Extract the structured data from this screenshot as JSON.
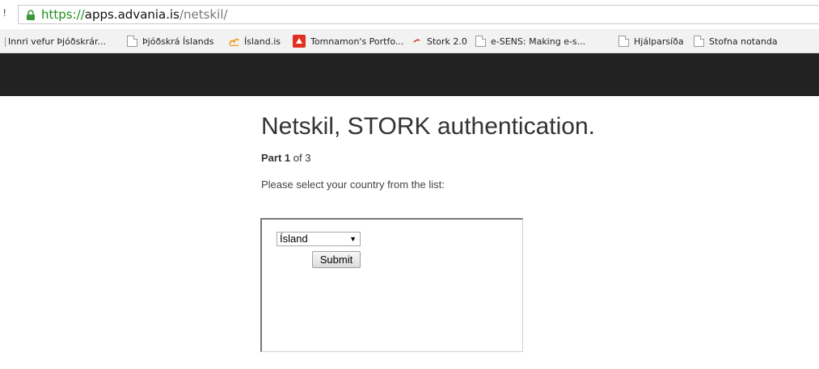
{
  "browser": {
    "url_scheme": "https://",
    "url_host": "apps.advania.is",
    "url_path": "/netskil/",
    "left_edge_glyph": "!"
  },
  "bookmarks": [
    {
      "label": "Innri vefur Þjóðskrár...",
      "icon": "none"
    },
    {
      "label": "Þjóðskrá Íslands",
      "icon": "page-icon"
    },
    {
      "label": "Ísland.is",
      "icon": "island-is-logo-icon"
    },
    {
      "label": "Tomnamon's Portfo...",
      "icon": "portfolio-icon"
    },
    {
      "label": "Stork 2.0",
      "icon": "stork-icon"
    },
    {
      "label": "e-SENS: Making e-s...",
      "icon": "page-icon"
    },
    {
      "label": "Hjálparsíða",
      "icon": "page-icon"
    },
    {
      "label": "Stofna notanda",
      "icon": "page-icon"
    }
  ],
  "page": {
    "title": "Netskil, STORK authentication.",
    "part_label": "Part 1",
    "part_suffix": " of 3",
    "instruction": "Please select your country from the list:"
  },
  "form": {
    "selected_country": "Ísland",
    "submit_label": "Submit"
  },
  "colors": {
    "header_band": "#222222",
    "https_green": "#1a8f1a"
  }
}
